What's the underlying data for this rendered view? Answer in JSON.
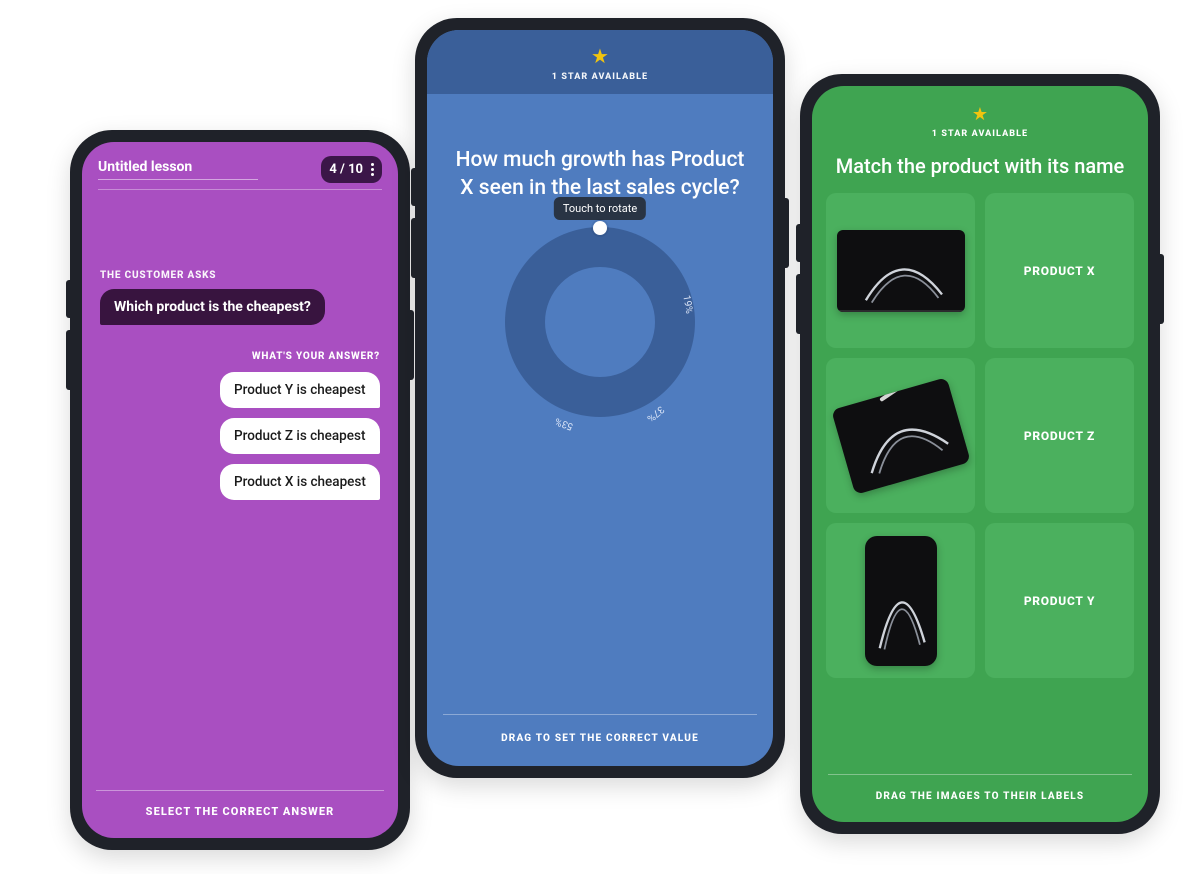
{
  "phone1": {
    "lesson_title": "Untitled lesson",
    "counter": "4 / 10",
    "ask_label": "THE CUSTOMER ASKS",
    "ask_text": "Which product is the cheapest?",
    "answer_label": "WHAT'S YOUR ANSWER?",
    "answers": [
      "Product Y is cheapest",
      "Product Z is cheapest",
      "Product X is cheapest"
    ],
    "footer": "SELECT THE CORRECT ANSWER"
  },
  "phone2": {
    "star_label": "1 STAR AVAILABLE",
    "question": "How much growth has Product X seen in the last sales cycle?",
    "tooltip": "Touch to rotate",
    "ticks": [
      "19%",
      "37%",
      "53%"
    ],
    "footer": "DRAG TO SET THE CORRECT VALUE"
  },
  "phone3": {
    "star_label": "1 STAR AVAILABLE",
    "title": "Match the product with its name",
    "labels": [
      "PRODUCT X",
      "PRODUCT Z",
      "PRODUCT Y"
    ],
    "footer": "DRAG THE IMAGES TO THEIR LABELS"
  },
  "chart_data": {
    "type": "pie",
    "title": "Growth dial selector",
    "values": [
      19,
      37,
      53
    ],
    "labels": [
      "19%",
      "37%",
      "53%"
    ],
    "selected_index": null
  }
}
